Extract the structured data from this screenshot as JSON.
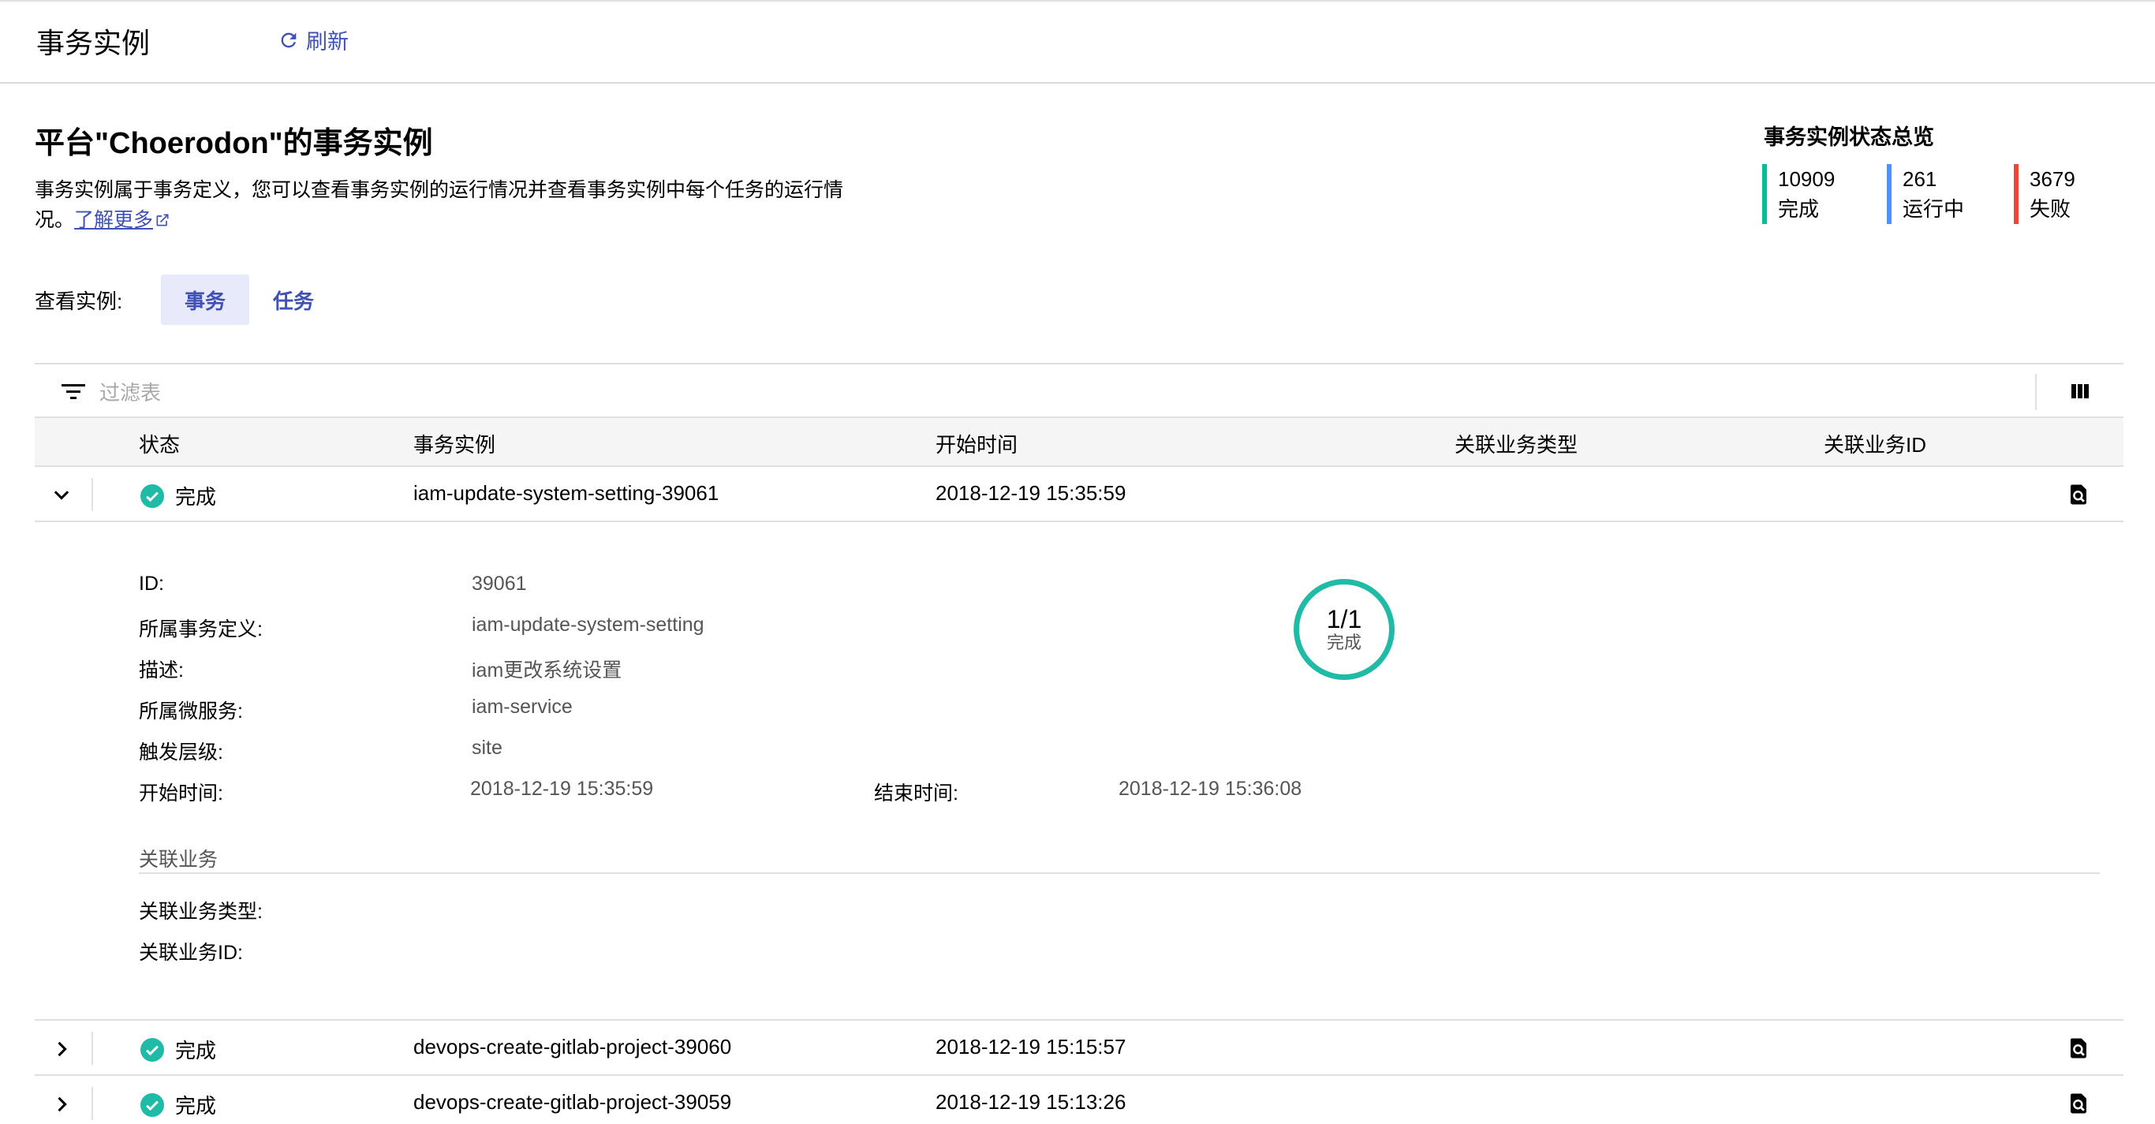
{
  "header": {
    "title": "事务实例",
    "refresh_label": "刷新"
  },
  "page": {
    "title": "平台\"Choerodon\"的事务实例",
    "description": "事务实例属于事务定义，您可以查看事务实例的运行情况并查看事务实例中每个任务的运行情况。",
    "learn_more": "了解更多"
  },
  "overview": {
    "title": "事务实例状态总览",
    "stats": [
      {
        "count": "10909",
        "label": "完成",
        "color": "#00bf96"
      },
      {
        "count": "261",
        "label": "运行中",
        "color": "#4d90fe"
      },
      {
        "count": "3679",
        "label": "失败",
        "color": "#f44336"
      }
    ]
  },
  "view": {
    "label": "查看实例:",
    "options": [
      "事务",
      "任务"
    ],
    "selected": "事务"
  },
  "table": {
    "filter_placeholder": "过滤表",
    "columns": [
      "状态",
      "事务实例",
      "开始时间",
      "关联业务类型",
      "关联业务ID"
    ],
    "rows": [
      {
        "status": "完成",
        "instance": "iam-update-system-setting-39061",
        "start_time": "2018-12-19 15:35:59",
        "biz_type": "",
        "biz_id": "",
        "expanded": true
      },
      {
        "status": "完成",
        "instance": "devops-create-gitlab-project-39060",
        "start_time": "2018-12-19 15:15:57",
        "biz_type": "",
        "biz_id": "",
        "expanded": false
      },
      {
        "status": "完成",
        "instance": "devops-create-gitlab-project-39059",
        "start_time": "2018-12-19 15:13:26",
        "biz_type": "",
        "biz_id": "",
        "expanded": false
      }
    ]
  },
  "detail": {
    "id_label": "ID:",
    "id": "39061",
    "definition_label": "所属事务定义:",
    "definition": "iam-update-system-setting",
    "desc_label": "描述:",
    "desc": "iam更改系统设置",
    "service_label": "所属微服务:",
    "service": "iam-service",
    "level_label": "触发层级:",
    "level": "site",
    "start_label": "开始时间:",
    "start": "2018-12-19 15:35:59",
    "end_label": "结束时间:",
    "end": "2018-12-19 15:36:08",
    "progress": {
      "text": "1/1",
      "label": "完成",
      "value": 1.0
    },
    "related_title": "关联业务",
    "related_type_label": "关联业务类型:",
    "related_id_label": "关联业务ID:"
  }
}
